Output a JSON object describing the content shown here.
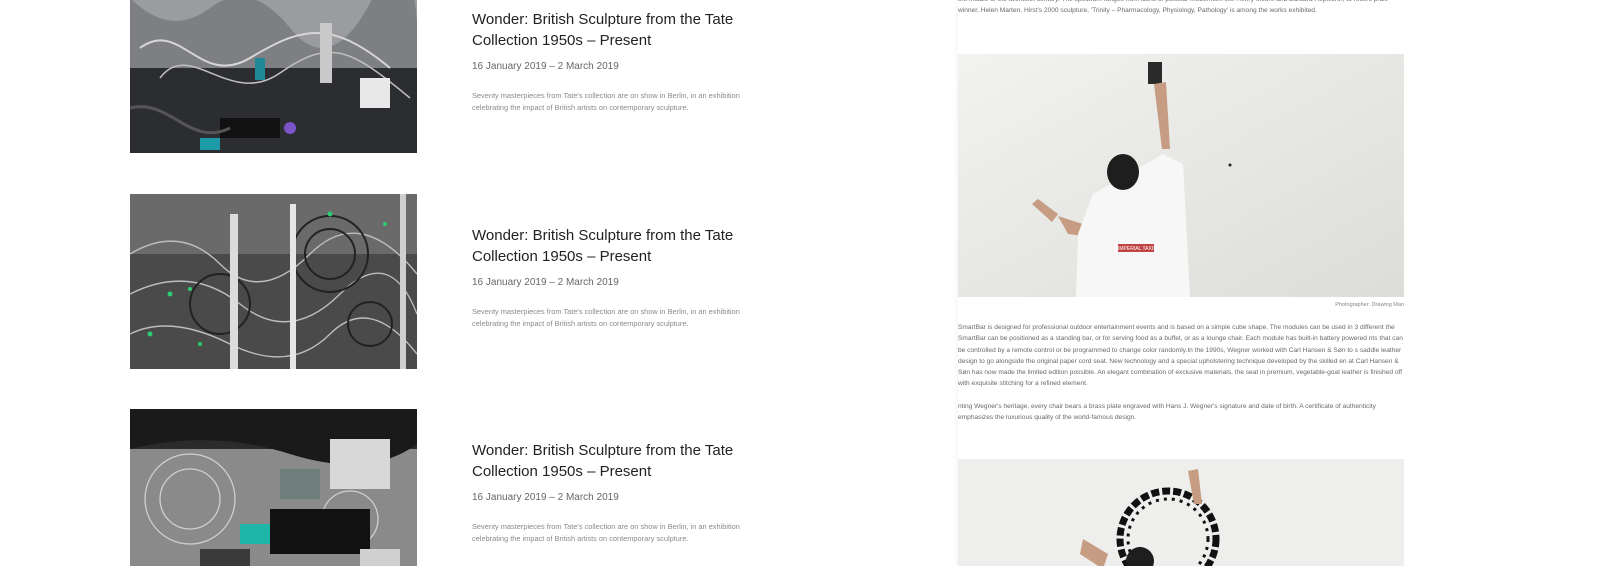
{
  "exhibitions": [
    {
      "title": "Wonder: British Sculpture from the Tate Collection 1950s – Present",
      "dates": "16 January 2019 – 2 March 2019",
      "description": "Seventy masterpieces from Tate's collection are on show in Berlin, in an exhibition celebrating the impact of British artists on contemporary sculpture."
    },
    {
      "title": "Wonder: British Sculpture from the Tate Collection 1950s – Present",
      "dates": "16 January 2019 – 2 March 2019",
      "description": "Seventy masterpieces from Tate's collection are on show in Berlin, in an exhibition celebrating the impact of British artists on contemporary sculpture."
    },
    {
      "title": "Wonder: British Sculpture from the Tate Collection 1950s – Present",
      "dates": "16 January 2019 – 2 March 2019",
      "description": "Seventy masterpieces from Tate's collection are on show in Berlin, in an exhibition celebrating the impact of British artists on contemporary sculpture."
    }
  ],
  "article": {
    "intro_text": "the middle of the twentieth century. The spectrum ranges from icons of postwar modernism like Henry Moore and Barbara Hepworth, to recent prize winner, Helen Marten. Hirst's 2000 sculpture, 'Trinity – Pharmacology, Physiology, Pathology' is among the works exhibited.",
    "shirt_text": "IMPERIAL TAXIS",
    "photo_caption": "Photographer: Drawing Man",
    "body_para_1": "SmartBar is designed for professional outdoor entertainment events and is based on a simple cube shape. The modules can be used in 3 different the SmartBar can be positioned as a standing bar, or for serving food as a buffet, or as a lounge chair. Each module has built-in battery powered nts that can be controlled by a remote control or be programmed to change color randomly.In the 1990s, Wegner worked with Carl Hansen & Søn to s saddle leather design to go alongside the original paper cord seat. New technology and a special upholstering technique developed by the skilled en at Carl Hansen & Søn has now made the limited edition possible. An elegant combination of exclusive materials, the seat in premium, vegetable-goat leather is finished off with exquisite stitching for a refined element.",
    "body_para_2": "nting Wegner's heritage, every chair bears a brass plate engraved with Hans J. Wegner's signature and date of birth. A certificate of authenticity emphasizes the luxurious quality of the world-famous design."
  }
}
